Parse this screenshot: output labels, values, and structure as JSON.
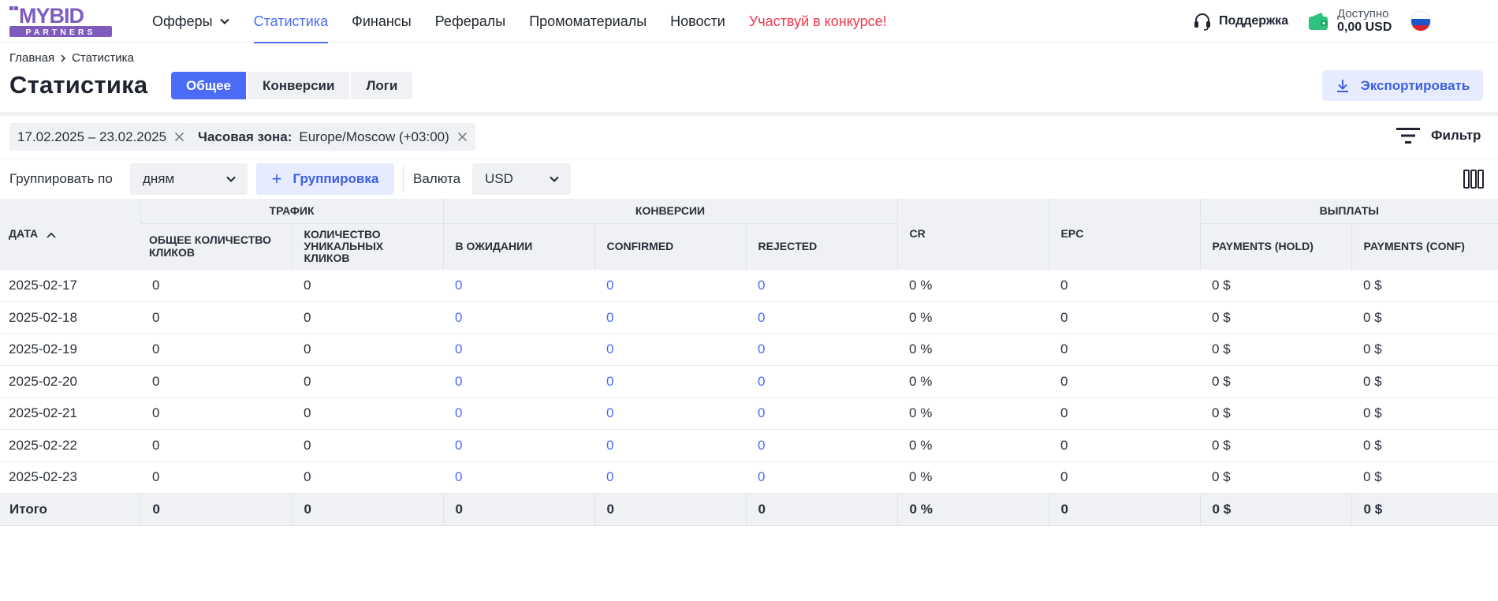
{
  "logo": {
    "text_top": "MYBID",
    "text_bottom": "PARTNERS",
    "brand_color": "#7e5bbd"
  },
  "nav": {
    "items": [
      {
        "label": "Офферы",
        "state": "dropdown"
      },
      {
        "label": "Статистика",
        "state": "active"
      },
      {
        "label": "Финансы",
        "state": "normal"
      },
      {
        "label": "Рефералы",
        "state": "normal"
      },
      {
        "label": "Промоматериалы",
        "state": "normal"
      },
      {
        "label": "Новости",
        "state": "normal"
      },
      {
        "label": "Участвуй в конкурсе!",
        "state": "promo"
      }
    ]
  },
  "header": {
    "support_label": "Поддержка",
    "balance_caption": "Доступно",
    "balance_amount": "0,00 USD",
    "language_flag": "ru-flag-icon"
  },
  "breadcrumb": {
    "home": "Главная",
    "current": "Статистика"
  },
  "page": {
    "title": "Статистика",
    "tabs": [
      "Общее",
      "Конверсии",
      "Логи"
    ],
    "active_tab": "Общее",
    "export_label": "Экспортировать"
  },
  "filters": {
    "date_range": "17.02.2025 – 23.02.2025",
    "timezone_label": "Часовая зона:",
    "timezone_value": "Europe/Moscow (+03:00)",
    "filter_label": "Фильтр"
  },
  "grouping": {
    "group_by_label": "Группировать по",
    "group_by_value": "дням",
    "add_group_label": "Группировка",
    "currency_label": "Валюта",
    "currency_value": "USD"
  },
  "table": {
    "group_headers": [
      "Трафик",
      "Конверсии",
      "Выплаты"
    ],
    "headers": {
      "date": "Дата",
      "total_clicks": "Общее количество кликов",
      "unique_clicks": "Количество уникальных кликов",
      "pending": "В ожидании",
      "confirmed": "Confirmed",
      "rejected": "Rejected",
      "cr": "CR",
      "epc": "EPC",
      "payments_hold": "Payments (hold)",
      "payments_conf": "Payments (conf)"
    },
    "rows": [
      {
        "date": "2025-02-17",
        "total_clicks": "0",
        "unique_clicks": "0",
        "pending": "0",
        "confirmed": "0",
        "rejected": "0",
        "cr": "0 %",
        "epc": "0",
        "payments_hold": "0 $",
        "payments_conf": "0 $"
      },
      {
        "date": "2025-02-18",
        "total_clicks": "0",
        "unique_clicks": "0",
        "pending": "0",
        "confirmed": "0",
        "rejected": "0",
        "cr": "0 %",
        "epc": "0",
        "payments_hold": "0 $",
        "payments_conf": "0 $"
      },
      {
        "date": "2025-02-19",
        "total_clicks": "0",
        "unique_clicks": "0",
        "pending": "0",
        "confirmed": "0",
        "rejected": "0",
        "cr": "0 %",
        "epc": "0",
        "payments_hold": "0 $",
        "payments_conf": "0 $"
      },
      {
        "date": "2025-02-20",
        "total_clicks": "0",
        "unique_clicks": "0",
        "pending": "0",
        "confirmed": "0",
        "rejected": "0",
        "cr": "0 %",
        "epc": "0",
        "payments_hold": "0 $",
        "payments_conf": "0 $"
      },
      {
        "date": "2025-02-21",
        "total_clicks": "0",
        "unique_clicks": "0",
        "pending": "0",
        "confirmed": "0",
        "rejected": "0",
        "cr": "0 %",
        "epc": "0",
        "payments_hold": "0 $",
        "payments_conf": "0 $"
      },
      {
        "date": "2025-02-22",
        "total_clicks": "0",
        "unique_clicks": "0",
        "pending": "0",
        "confirmed": "0",
        "rejected": "0",
        "cr": "0 %",
        "epc": "0",
        "payments_hold": "0 $",
        "payments_conf": "0 $"
      },
      {
        "date": "2025-02-23",
        "total_clicks": "0",
        "unique_clicks": "0",
        "pending": "0",
        "confirmed": "0",
        "rejected": "0",
        "cr": "0 %",
        "epc": "0",
        "payments_hold": "0 $",
        "payments_conf": "0 $"
      }
    ],
    "total": {
      "label": "Итого",
      "total_clicks": "0",
      "unique_clicks": "0",
      "pending": "0",
      "confirmed": "0",
      "rejected": "0",
      "cr": "0 %",
      "epc": "0",
      "payments_hold": "0 $",
      "payments_conf": "0 $"
    }
  },
  "colors": {
    "accent": "#4a6cf7",
    "promo": "#f0364d",
    "chip_bg": "#eff1f5",
    "light_accent_bg": "#e6ecfe",
    "wallet": "#2ec27e"
  }
}
